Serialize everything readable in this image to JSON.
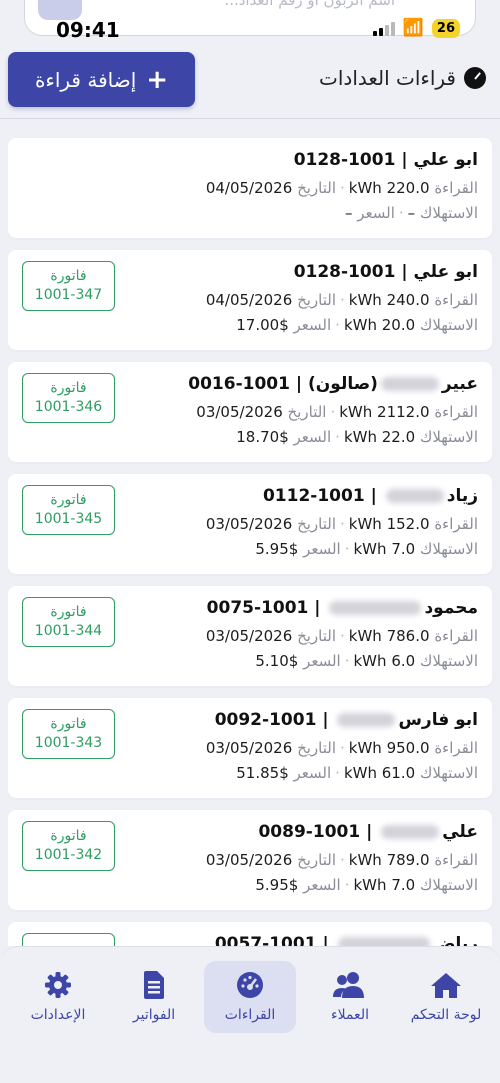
{
  "status_bar": {
    "time": "09:41",
    "battery": "26"
  },
  "search": {
    "placeholder": "اسم الزبون أو رقم العداد..."
  },
  "header": {
    "title": "قراءات العدادات",
    "add_button": "إضافة قراءة"
  },
  "labels": {
    "reading": "القراءة",
    "date": "التاريخ",
    "consumption": "الاستهلاك",
    "price": "السعر",
    "invoice": "فاتورة"
  },
  "readings": [
    {
      "name": "ابو علي",
      "meter": "1001-0128",
      "reading": "kWh 220.0",
      "date": "04/05/2026",
      "consumption": "–",
      "price": "–",
      "invoice": ""
    },
    {
      "name": "ابو علي",
      "meter": "1001-0128",
      "reading": "kWh 240.0",
      "date": "04/05/2026",
      "consumption": "20.0 kWh",
      "price": "$17.00",
      "invoice": "1001-347"
    },
    {
      "name": "عبير",
      "name_suffix": "(صالون)",
      "meter": "1001-0016",
      "reading": "kWh 2112.0",
      "date": "03/05/2026",
      "consumption": "22.0 kWh",
      "price": "$18.70",
      "invoice": "1001-346"
    },
    {
      "name": "زياد",
      "meter": "1001-0112",
      "reading": "kWh 152.0",
      "date": "03/05/2026",
      "consumption": "7.0 kWh",
      "price": "$5.95",
      "invoice": "1001-345"
    },
    {
      "name": "محمود",
      "meter": "1001-0075",
      "reading": "kWh 786.0",
      "date": "03/05/2026",
      "consumption": "6.0 kWh",
      "price": "$5.10",
      "invoice": "1001-344"
    },
    {
      "name": "ابو فارس",
      "meter": "1001-0092",
      "reading": "kWh 950.0",
      "date": "03/05/2026",
      "consumption": "61.0 kWh",
      "price": "$51.85",
      "invoice": "1001-343"
    },
    {
      "name": "علي",
      "meter": "1001-0089",
      "reading": "kWh 789.0",
      "date": "03/05/2026",
      "consumption": "7.0 kWh",
      "price": "$5.95",
      "invoice": "1001-342"
    },
    {
      "name": "رياض",
      "meter": "1001-0057",
      "reading": "",
      "date": "",
      "consumption": "",
      "price": "",
      "invoice": ""
    }
  ],
  "nav": [
    {
      "label": "لوحة التحكم",
      "icon": "home-icon"
    },
    {
      "label": "العملاء",
      "icon": "users-icon"
    },
    {
      "label": "القراءات",
      "icon": "gauge-icon",
      "active": true
    },
    {
      "label": "الفواتير",
      "icon": "invoice-icon"
    },
    {
      "label": "الإعدادات",
      "icon": "gear-icon"
    }
  ],
  "colors": {
    "primary": "#3d46a6",
    "invoice_green": "#2f9c62",
    "background": "#eef0f6"
  }
}
